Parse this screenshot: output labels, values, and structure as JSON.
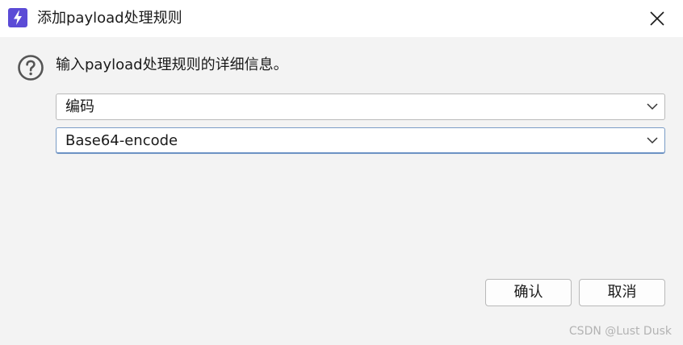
{
  "window": {
    "title": "添加payload处理规则",
    "icon": "bolt-icon",
    "close_icon": "close-icon"
  },
  "content": {
    "prompt": "输入payload处理规则的详细信息。",
    "prompt_icon": "question-icon"
  },
  "rule_type_select": {
    "value": "编码"
  },
  "rule_option_select": {
    "value": "Base64-encode"
  },
  "buttons": {
    "ok_label": "确认",
    "cancel_label": "取消"
  },
  "watermark": "CSDN @Lust Dusk",
  "colors": {
    "accent": "#5b4bd6",
    "background": "#f3f3f3",
    "focus_border": "#5c86c0"
  }
}
